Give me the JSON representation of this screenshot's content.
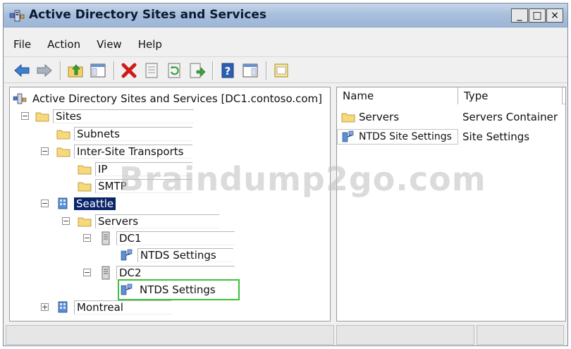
{
  "window": {
    "title": "Active Directory Sites and Services",
    "min_label": "_",
    "max_label": "□",
    "close_label": "×"
  },
  "menu": {
    "items": [
      "File",
      "Action",
      "View",
      "Help"
    ]
  },
  "toolbar": {
    "icons": [
      "back-arrow-icon",
      "forward-arrow-icon",
      "up-folder-icon",
      "show-hide-tree-icon",
      "delete-icon",
      "properties-icon",
      "refresh-icon",
      "export-list-icon",
      "help-icon",
      "action-pane-icon",
      "new-window-icon"
    ]
  },
  "tree": {
    "root": "Active Directory Sites and Services [DC1.contoso.com]",
    "sites": "Sites",
    "subnets": "Subnets",
    "inter_site": "Inter-Site Transports",
    "ip": "IP",
    "smtp": "SMTP",
    "seattle": "Seattle",
    "servers": "Servers",
    "dc1": "DC1",
    "dc1_ntds": "NTDS Settings",
    "dc2": "DC2",
    "dc2_ntds": "NTDS Settings",
    "montreal": "Montreal",
    "expand_sign": "+",
    "collapse_sign": "−"
  },
  "list": {
    "columns": [
      "Name",
      "Type"
    ],
    "rows": [
      {
        "name": "Servers",
        "type": "Servers Container"
      },
      {
        "name": "NTDS Site Settings",
        "type": "Site Settings"
      }
    ]
  },
  "watermark": "Braindump2go.com",
  "colors": {
    "selection": "#0a246a",
    "focus_outline": "#3ac23a",
    "title_gradient": "#a9c0dd"
  }
}
